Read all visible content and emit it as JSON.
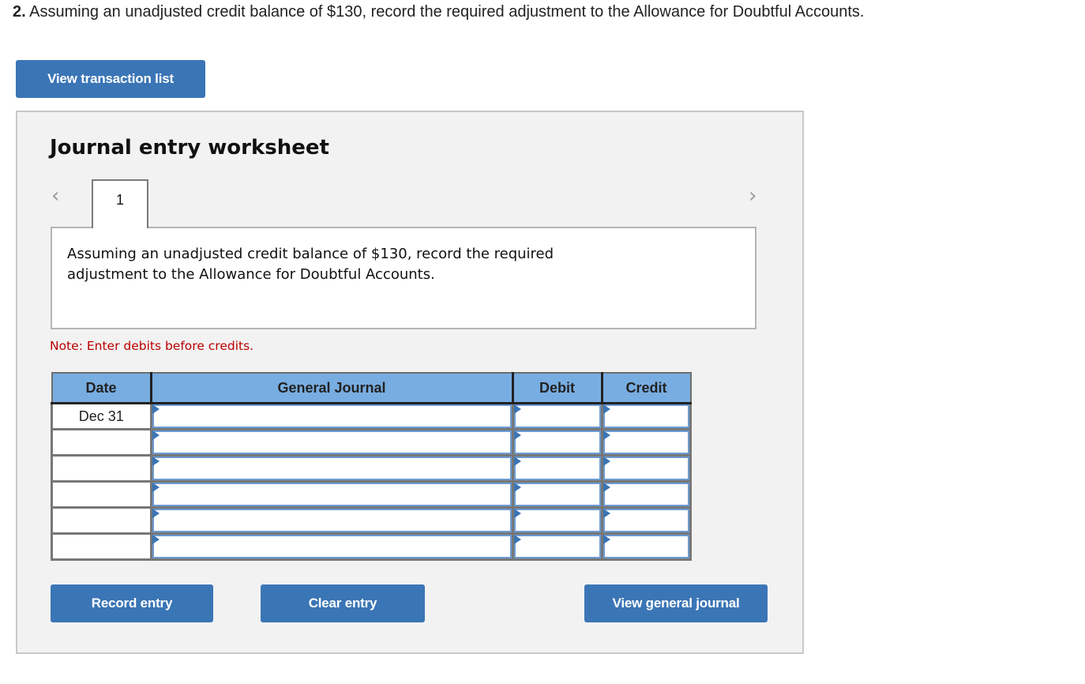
{
  "question": {
    "number": "2.",
    "text": "Assuming an unadjusted credit balance of $130, record the required adjustment to the Allowance for Doubtful Accounts."
  },
  "view_transaction_list_label": "View transaction list",
  "worksheet": {
    "title": "Journal entry worksheet",
    "prev_icon": "chevron-left-icon",
    "next_icon": "chevron-right-icon",
    "tabs": [
      {
        "label": "1"
      }
    ],
    "description": "Assuming an unadjusted credit balance of $130, record the required adjustment to the Allowance for Doubtful Accounts.",
    "note": "Note: Enter debits before credits.",
    "table": {
      "headers": [
        "Date",
        "General Journal",
        "Debit",
        "Credit"
      ],
      "rows": [
        {
          "date": "Dec 31",
          "account": "",
          "debit": "",
          "credit": ""
        },
        {
          "date": "",
          "account": "",
          "debit": "",
          "credit": ""
        },
        {
          "date": "",
          "account": "",
          "debit": "",
          "credit": ""
        },
        {
          "date": "",
          "account": "",
          "debit": "",
          "credit": ""
        },
        {
          "date": "",
          "account": "",
          "debit": "",
          "credit": ""
        },
        {
          "date": "",
          "account": "",
          "debit": "",
          "credit": ""
        }
      ]
    },
    "buttons": {
      "record": "Record entry",
      "clear": "Clear entry",
      "view_general_journal": "View general journal"
    }
  },
  "colors": {
    "button_blue": "#3a75b6",
    "header_blue": "#78ade2",
    "note_red": "#bb0000",
    "panel_bg": "#f2f2f2"
  }
}
